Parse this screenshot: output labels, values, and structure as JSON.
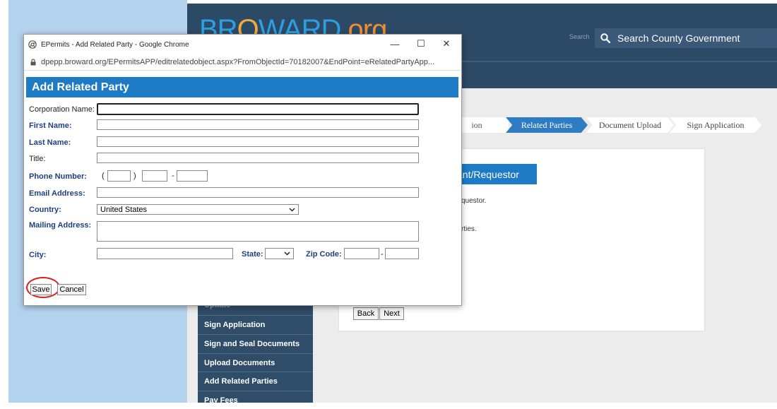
{
  "site": {
    "logo_part1": "BR",
    "logo_part2": "O",
    "logo_part3": "WARD",
    "logo_part4": ".org",
    "search_small": "Search",
    "search_text": "Search County Government"
  },
  "steps": [
    {
      "label": "ion"
    },
    {
      "label": "Related Parties"
    },
    {
      "label": "Document Upload"
    },
    {
      "label": "Sign Application"
    }
  ],
  "panel": {
    "title": "cant/Requestor",
    "line1": "questor.",
    "line2": "rties.",
    "back_label": "Back",
    "next_label": "Next"
  },
  "side_nav": [
    {
      "label": "Update"
    },
    {
      "label": "Sign Application"
    },
    {
      "label": "Sign and Seal Documents"
    },
    {
      "label": "Upload Documents"
    },
    {
      "label": "Add Related Parties"
    },
    {
      "label": "Pay Fees"
    }
  ],
  "window": {
    "title": "EPermits - Add Related Party - Google Chrome",
    "url": "dpepp.broward.org/EPermitsAPP/editrelatedobject.aspx?FromObjectId=70182007&EndPoint=eRelatedPartyApp...",
    "minimize": "—",
    "maximize": "☐",
    "close": "✕"
  },
  "form": {
    "header": "Add Related Party",
    "corporation_name": {
      "label": "Corporation Name:",
      "value": ""
    },
    "first_name": {
      "label": "First Name:",
      "value": ""
    },
    "last_name": {
      "label": "Last Name:",
      "value": ""
    },
    "title": {
      "label": "Title:",
      "value": ""
    },
    "phone": {
      "label": "Phone Number:",
      "paren_open": "(",
      "paren_close": ")",
      "dash": "-"
    },
    "email": {
      "label": "Email Address:",
      "value": ""
    },
    "country": {
      "label": "Country:",
      "selected": "United States"
    },
    "mailing_address": {
      "label": "Mailing Address:",
      "value": ""
    },
    "city": {
      "label": "City:",
      "value": ""
    },
    "state": {
      "label": "State:",
      "selected": ""
    },
    "zip": {
      "label": "Zip Code:",
      "dash": "-"
    },
    "save_label": "Save",
    "cancel_label": "Cancel"
  },
  "colors": {
    "header_blue": "#1d7ac4",
    "site_navy": "#2c4a66",
    "highlight_red": "#d61f1f"
  }
}
